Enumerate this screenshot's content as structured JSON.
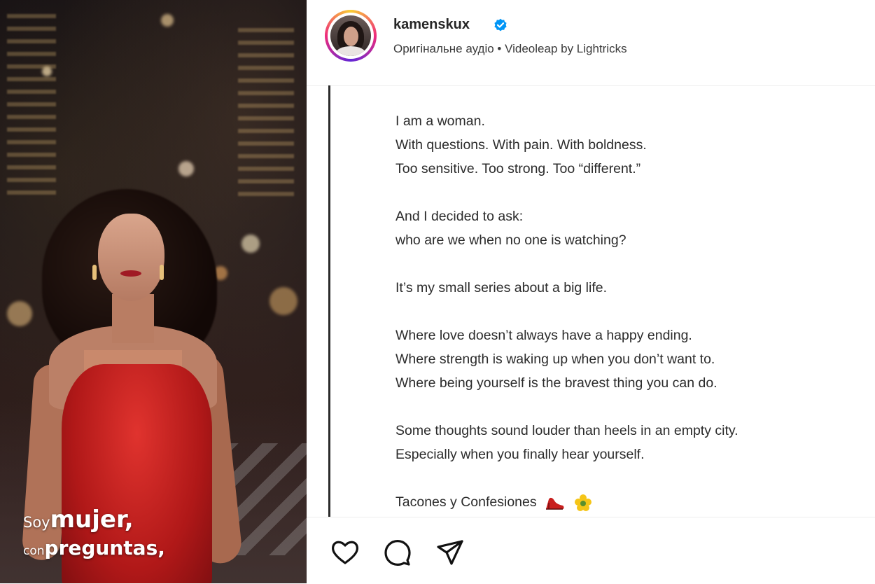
{
  "media": {
    "caption_line1_small": "Soy",
    "caption_line1_big": "mujer,",
    "caption_line2_small": "con",
    "caption_line2_big": "preguntas,"
  },
  "post": {
    "username": "kamenskux",
    "verified": true,
    "audio_info": "Оригінальне аудіо • Videoleap by Lightricks",
    "caption_paragraphs": [
      [
        "I am a woman.",
        "With questions. With pain. With boldness.",
        "Too sensitive. Too strong. Too “different.”"
      ],
      [
        "And I decided to ask:",
        "who are we when no one is watching?"
      ],
      [
        "It’s my small series about a big life."
      ],
      [
        "Where love doesn’t always have a happy ending.",
        "Where strength is waking up when you don’t want to.",
        "Where being yourself is the bravest thing you can do."
      ],
      [
        "Some thoughts sound louder than heels in an empty city.",
        "Especially when you finally hear yourself."
      ],
      [
        "Tacones y Confesiones"
      ]
    ],
    "caption_emojis": [
      "high-heel-shoe-icon",
      "sparkle-flower-icon"
    ]
  },
  "colors": {
    "verified_badge": "#0095f6",
    "text": "#2b2b2b",
    "dress": "#c41f1f"
  },
  "actions": {
    "icons": [
      "heart-icon",
      "comment-icon",
      "share-icon"
    ]
  }
}
